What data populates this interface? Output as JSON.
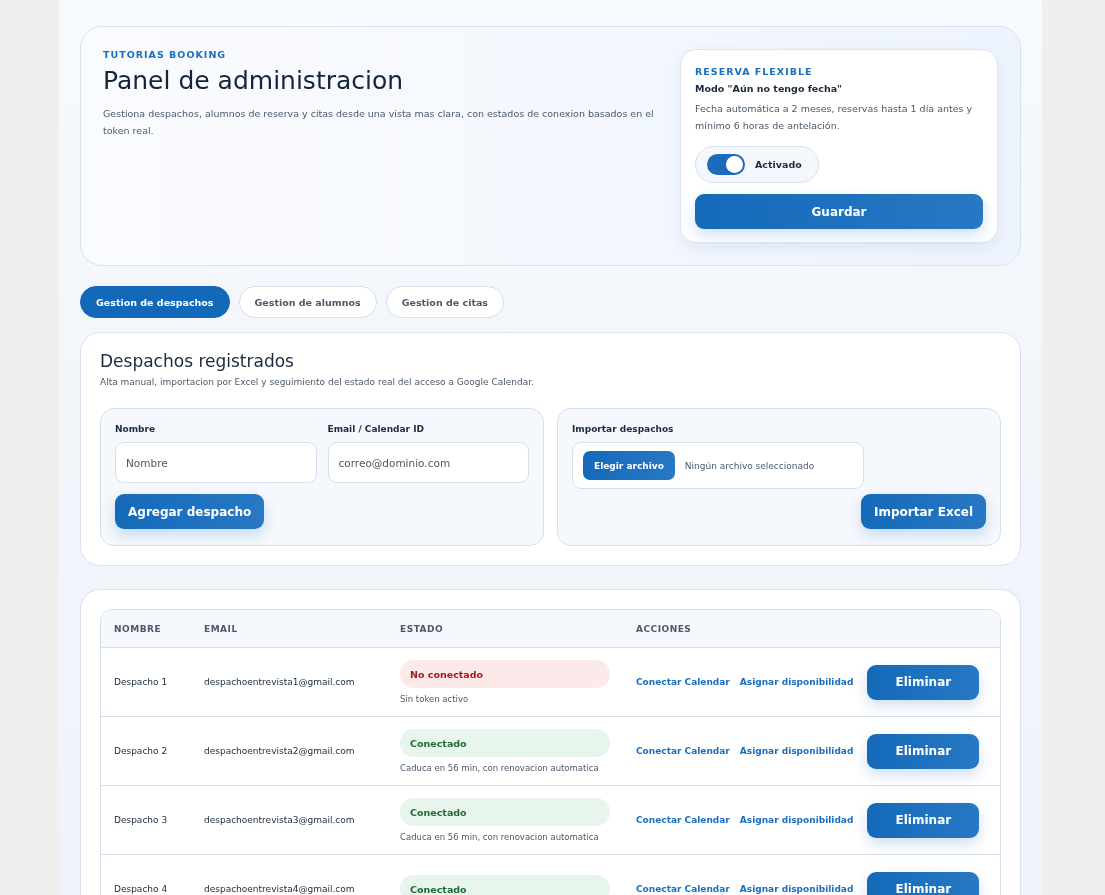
{
  "hero": {
    "eyebrow": "TUTORIAS BOOKING",
    "title": "Panel de administracion",
    "description": "Gestiona despachos, alumnos de reserva y citas desde una vista mas clara, con estados de conexion basados en el token real.",
    "flex_card": {
      "eyebrow": "RESERVA FLEXIBLE",
      "mode": "Modo \"Aún no tengo fecha\"",
      "description": "Fecha automática a 2 meses, reservas hasta 1 día antes y mínimo 6 horas de antelación.",
      "toggle": {
        "label": "Activado",
        "on": true
      },
      "save_button": "Guardar"
    }
  },
  "tabs": [
    {
      "label": "Gestion de despachos",
      "selected": true
    },
    {
      "label": "Gestion de alumnos",
      "selected": false
    },
    {
      "label": "Gestion de citas",
      "selected": false
    }
  ],
  "section": {
    "title": "Despachos registrados",
    "description": "Alta manual, importacion por Excel y seguimiento del estado real del acceso a Google Calendar.",
    "form": {
      "fields": [
        {
          "label": "Nombre",
          "placeholder": "Nombre"
        },
        {
          "label": "Email / Calendar ID",
          "placeholder": "correo@dominio.com"
        }
      ],
      "button": "Agregar despacho"
    },
    "import": {
      "label": "Importar despachos",
      "file_button": "Elegir archivo",
      "file_status": "Ningún archivo seleccionado",
      "button": "Importar Excel"
    }
  },
  "table": {
    "columns": [
      "NOMBRE",
      "EMAIL",
      "ESTADO",
      "ACCIONES"
    ],
    "rows": [
      {
        "name": "Despacho 1",
        "email": "despachoentrevista1@gmail.com",
        "status": "No conectado",
        "connected": false,
        "note": "Sin token activo",
        "actions": [
          "Conectar Calendar",
          "Asignar disponibilidad"
        ],
        "delete": "Eliminar"
      },
      {
        "name": "Despacho 2",
        "email": "despachoentrevista2@gmail.com",
        "status": "Conectado",
        "connected": true,
        "note": "Caduca en 56 min, con renovacion automatica",
        "actions": [
          "Conectar Calendar",
          "Asignar disponibilidad"
        ],
        "delete": "Eliminar"
      },
      {
        "name": "Despacho 3",
        "email": "despachoentrevista3@gmail.com",
        "status": "Conectado",
        "connected": true,
        "note": "Caduca en 56 min, con renovacion automatica",
        "actions": [
          "Conectar Calendar",
          "Asignar disponibilidad"
        ],
        "delete": "Eliminar"
      },
      {
        "name": "Despacho 4",
        "email": "despachoentrevista4@gmail.com",
        "status": "Conectado",
        "connected": true,
        "actions": [
          "Conectar Calendar",
          "Asignar disponibilidad"
        ],
        "delete": "Eliminar"
      }
    ]
  }
}
